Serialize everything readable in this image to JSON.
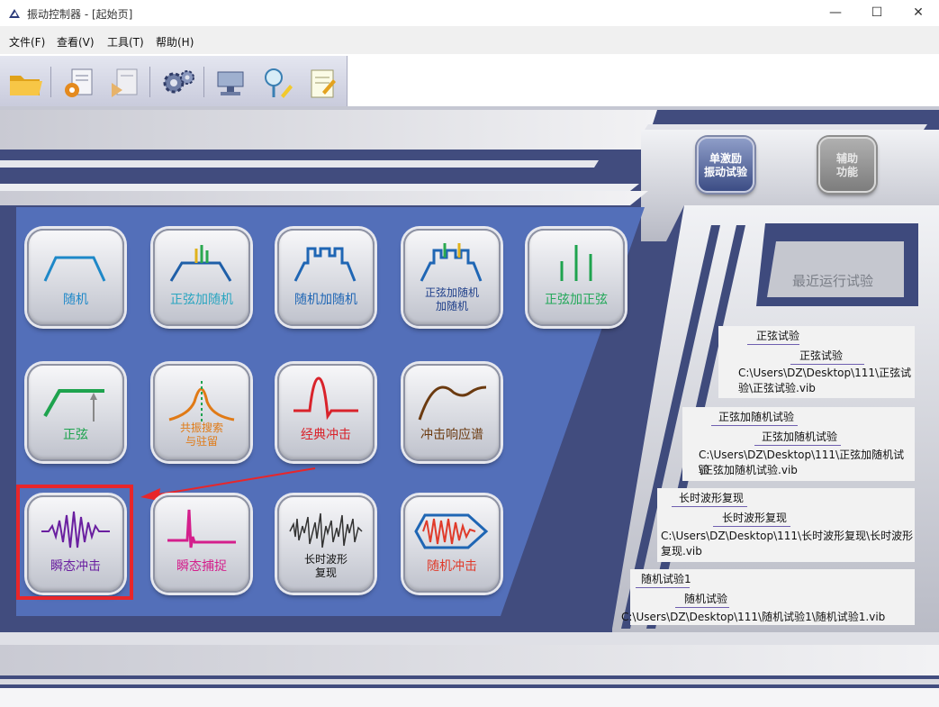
{
  "window": {
    "title": "振动控制器 - [起始页]",
    "min_glyph": "—",
    "max_glyph": "☐",
    "close_glyph": "✕"
  },
  "menu": [
    "文件(F)",
    "查看(V)",
    "工具(T)",
    "帮助(H)"
  ],
  "toolbar": [
    "open-folder-icon",
    "settings-doc-icon",
    "play-doc-icon",
    "gears-icon",
    "monitor-icon",
    "search-edit-icon",
    "notes-icon"
  ],
  "side_buttons": {
    "single_excite": {
      "line1": "单激励",
      "line2": "振动试验"
    },
    "assist": {
      "line1": "辅助",
      "line2": "功能"
    }
  },
  "tiles": {
    "random": "随机",
    "sine_on_random": "正弦加随机",
    "random_on_random": "随机加随机",
    "sine_random_random_l1": "正弦加随机",
    "sine_random_random_l2": "加随机",
    "sine_on_sine": "正弦加正弦",
    "sine": "正弦",
    "resonance_l1": "共振搜索",
    "resonance_l2": "与驻留",
    "classic_shock": "经典冲击",
    "srs": "冲击响应谱",
    "transient_shock": "瞬态冲击",
    "transient_capture": "瞬态捕捉",
    "long_wave_l1": "长时波形",
    "long_wave_l2": "复现",
    "random_shock": "随机冲击"
  },
  "colors": {
    "random": "#1e88c8",
    "sine_on_random": "#2aa5c0",
    "random_on_random": "#1f66b4",
    "sine_random_random": "#1f3f8a",
    "sine_on_sine": "#24a85a",
    "sine": "#1ea34e",
    "resonance": "#e07a16",
    "classic_shock": "#d9232b",
    "srs": "#6b3a10",
    "transient_shock": "#6a1fa0",
    "transient_capture": "#d41f8c",
    "long_wave": "#111111",
    "random_shock": "#e03a2a"
  },
  "recent": {
    "title": "最近运行试验",
    "items": [
      {
        "name": "正弦试验",
        "sub": "正弦试验",
        "path1": "C:\\Users\\DZ\\Desktop\\111\\正弦试",
        "path2": "验\\正弦试验.vib"
      },
      {
        "name": "正弦加随机试验",
        "sub": "正弦加随机试验",
        "path1": "C:\\Users\\DZ\\Desktop\\111\\正弦加随机试验",
        "path2": "\\正弦加随机试验.vib"
      },
      {
        "name": "长时波形复现",
        "sub": "长时波形复现",
        "path1": "C:\\Users\\DZ\\Desktop\\111\\长时波形复现\\长时波形",
        "path2": "复现.vib"
      },
      {
        "name": "随机试验1",
        "sub": "随机试验",
        "path1": "C:\\Users\\DZ\\Desktop\\111\\随机试验1\\随机试验1.vib",
        "path2": ""
      }
    ]
  }
}
